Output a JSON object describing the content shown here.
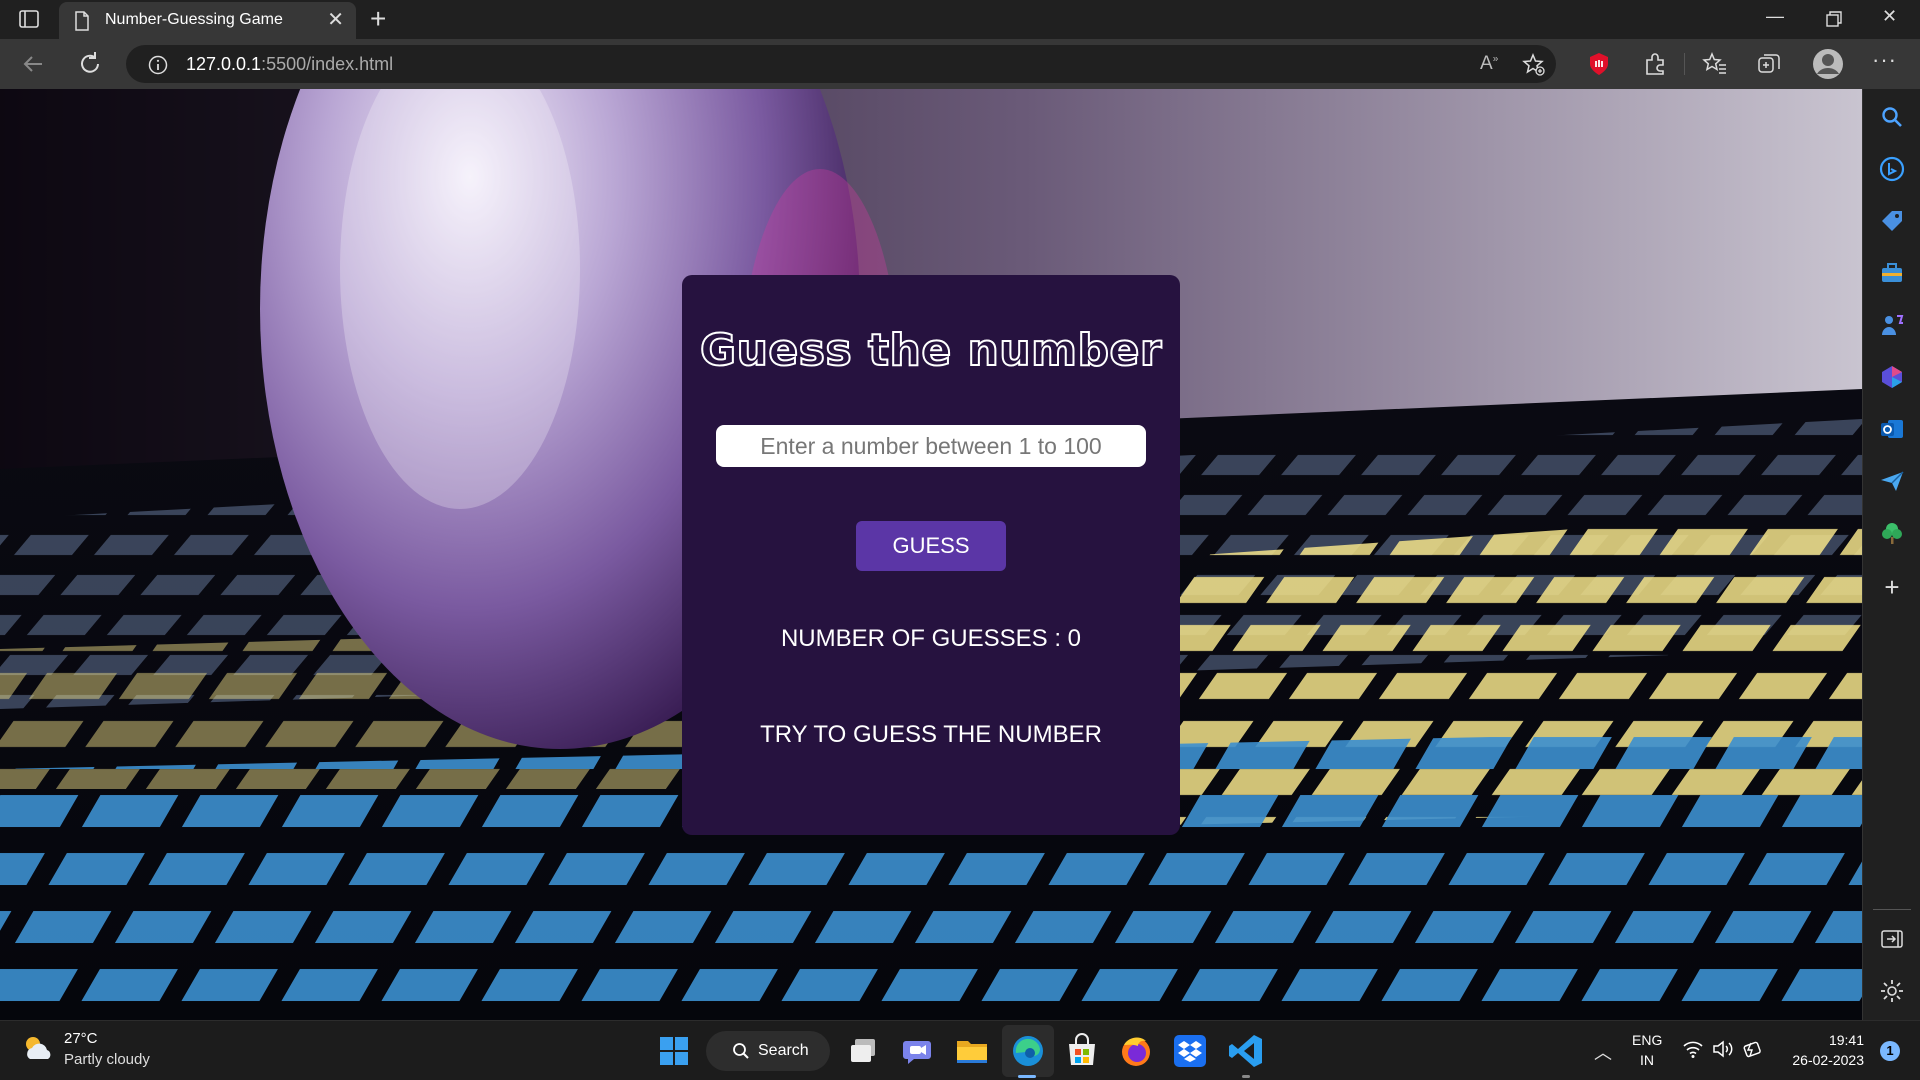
{
  "browser": {
    "tab": {
      "title": "Number-Guessing Game"
    },
    "address": {
      "host": "127.0.0.1",
      "rest": ":5500/index.html"
    }
  },
  "page": {
    "title": "Guess the number",
    "input_placeholder": "Enter a number between 1 to 100",
    "input_value": "",
    "guess_button": "GUESS",
    "guesses_label": "NUMBER OF GUESSES : ",
    "guesses_count": "0",
    "message": "TRY TO GUESS THE NUMBER",
    "colors": {
      "card": "#26123f",
      "button": "#5b36a6"
    }
  },
  "taskbar": {
    "weather": {
      "temp": "27°C",
      "desc": "Partly cloudy"
    },
    "search_label": "Search",
    "language": {
      "line1": "ENG",
      "line2": "IN"
    },
    "clock": {
      "time": "19:41",
      "date": "26-02-2023"
    },
    "notifications": "1"
  }
}
